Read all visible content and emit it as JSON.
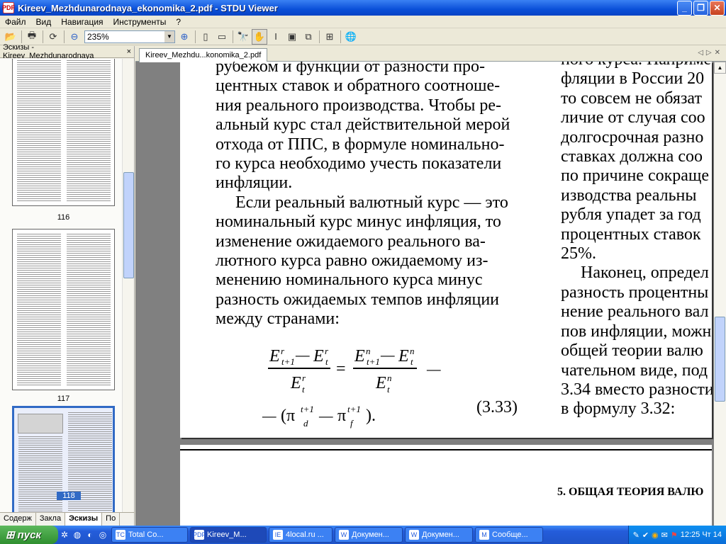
{
  "window": {
    "title": "Kireev_Mezhdunarodnaya_ekonomika_2.pdf - STDU Viewer",
    "app_icon": "pdf-icon",
    "controls": [
      "minimize",
      "maximize",
      "close"
    ]
  },
  "menu": {
    "items": [
      "Файл",
      "Вид",
      "Навигация",
      "Инструменты",
      "?"
    ]
  },
  "toolbar": {
    "zoom": "235%",
    "icons": [
      "open-icon",
      "print-icon",
      "rotate-icon",
      "zoom-out-icon",
      "zoom-in-icon",
      "single-page-icon",
      "fit-page-icon",
      "find-icon",
      "hand-tool-icon",
      "text-select-icon",
      "image-select-icon",
      "copy-icon",
      "snapshot-icon",
      "globe-icon"
    ]
  },
  "sidebar": {
    "header": "Эскизы - Kireev_Mezhdunarodnaya",
    "close": "×",
    "thumbnails": [
      {
        "label": "116"
      },
      {
        "label": "117"
      },
      {
        "label": "118",
        "selected": true
      }
    ],
    "tabs": [
      "Содерж",
      "Закла",
      "Эскизы",
      "По"
    ]
  },
  "document": {
    "tab_label": "Kireev_Mezhdu...konomika_2.pdf",
    "col1_lines": [
      "рубежом и функции от разности про-",
      "центных ставок и обратного соотноше-",
      "ния реального производства. Чтобы ре-",
      "альный курс стал действительной мерой",
      "отхода от ППС, в формуле номинально-",
      "го курса необходимо учесть показатели",
      "инфляции."
    ],
    "col1_para2_lines": [
      "Если реальный валютный курс — это",
      "номинальный курс минус инфляция, то",
      "изменение ожидаемого реального ва-",
      "лютного курса равно ожидаемому из-",
      "менению номинального курса минус",
      "разность ожидаемых темпов инфляции",
      "между странами:"
    ],
    "formula_number": "(3.33)",
    "col2_lines": [
      "ного курса. Наприме",
      "фляции в России 20",
      "то совсем не обязат",
      "личие от случая соо",
      "долгосрочная разно",
      "ставках должна соо",
      "по причине сокраще",
      "изводства реальны",
      "рубля упадет за год",
      "процентных ставок",
      "25%."
    ],
    "col2_para2_lines": [
      "Наконец, определ",
      "разность процентны",
      "нение реального вал",
      "пов инфляции, можн",
      "общей теории валю",
      "чательном виде, под",
      "3.34 вместо разности",
      "в формулу 3.32:"
    ],
    "page2_heading": "5. ОБЩАЯ ТЕОРИЯ ВАЛЮ"
  },
  "taskbar": {
    "start": "пуск",
    "tasks": [
      {
        "label": "Total Co...",
        "icon": "TC"
      },
      {
        "label": "Kireev_M...",
        "icon": "PDF",
        "active": true
      },
      {
        "label": "4local.ru ...",
        "icon": "IE"
      },
      {
        "label": "Докумен...",
        "icon": "W"
      },
      {
        "label": "Докумен...",
        "icon": "W"
      },
      {
        "label": "Сообще...",
        "icon": "M"
      }
    ],
    "clock": "12:25 Чт 14"
  }
}
